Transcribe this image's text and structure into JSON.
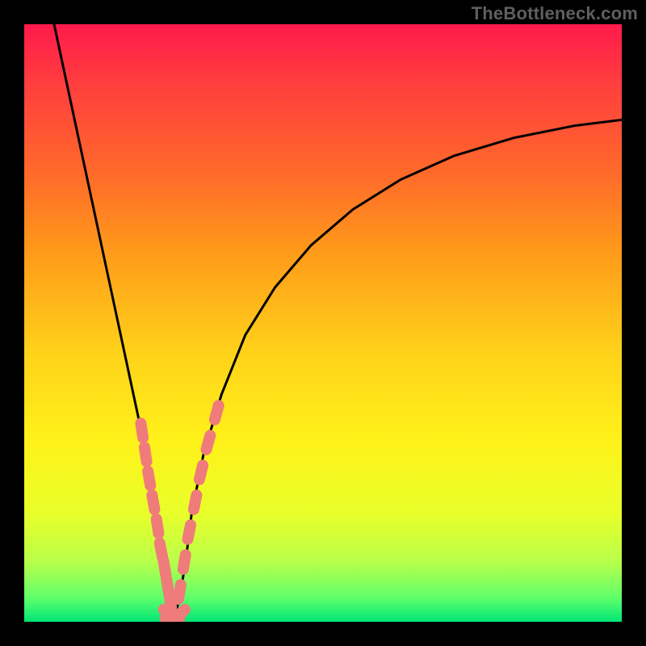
{
  "watermark": "TheBottleneck.com",
  "chart_data": {
    "type": "line",
    "title": "",
    "xlabel": "",
    "ylabel": "",
    "xlim": [
      0,
      100
    ],
    "ylim": [
      0,
      100
    ],
    "grid": false,
    "legend": false,
    "notch_x": 25,
    "series": [
      {
        "name": "bottleneck-curve",
        "color": "#000000",
        "x": [
          5,
          8,
          11,
          14,
          17,
          20,
          22,
          23,
          24,
          25,
          26,
          27,
          28,
          30,
          33,
          37,
          42,
          48,
          55,
          63,
          72,
          82,
          92,
          100
        ],
        "y": [
          100,
          86,
          72,
          58,
          44,
          30,
          18,
          10,
          4,
          0,
          4,
          10,
          18,
          28,
          38,
          48,
          56,
          63,
          69,
          74,
          78,
          81,
          83,
          84
        ]
      },
      {
        "name": "sample-dots-left",
        "color": "#ef7b7b",
        "segment_style": "rounded",
        "x": [
          19.7,
          20.3,
          20.9,
          21.6,
          22.3,
          22.9,
          23.5,
          24.0,
          24.5
        ],
        "y": [
          32,
          28,
          24,
          20,
          16,
          12,
          9,
          6,
          3
        ]
      },
      {
        "name": "sample-dots-right",
        "color": "#ef7b7b",
        "segment_style": "rounded",
        "x": [
          26.0,
          26.8,
          27.6,
          28.6,
          29.6,
          30.8,
          32.2
        ],
        "y": [
          5,
          10,
          15,
          20,
          25,
          30,
          35
        ]
      },
      {
        "name": "sample-dots-bottom",
        "color": "#ef7b7b",
        "segment_style": "rounded",
        "x": [
          24.2,
          24.8,
          25.4,
          26.0
        ],
        "y": [
          1.2,
          0.6,
          0.6,
          1.2
        ]
      }
    ]
  }
}
